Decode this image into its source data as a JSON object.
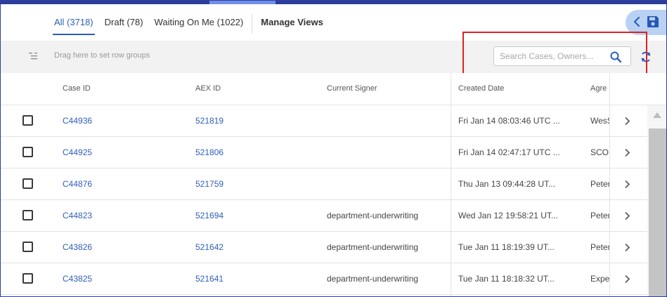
{
  "tabs": [
    {
      "label": "All (3718)",
      "active": true
    },
    {
      "label": "Draft (78)",
      "active": false
    },
    {
      "label": "Waiting On Me (1022)",
      "active": false
    }
  ],
  "manage_views_label": "Manage Views",
  "toolbar": {
    "row_group_hint": "Drag here to set row groups",
    "search_placeholder": "Search Cases, Owners..."
  },
  "table": {
    "columns": [
      "Case ID",
      "AEX ID",
      "Current Signer",
      "Created Date",
      "Agre"
    ],
    "rows": [
      {
        "case_id": "C44936",
        "aex_id": "521819",
        "signer": "",
        "created": "Fri Jan 14 08:03:46 UTC ...",
        "agre": "WesS"
      },
      {
        "case_id": "C44925",
        "aex_id": "521806",
        "signer": "",
        "created": "Fri Jan 14 02:47:17 UTC ...",
        "agre": "SCOF"
      },
      {
        "case_id": "C44876",
        "aex_id": "521759",
        "signer": "",
        "created": "Thu Jan 13 09:44:28 UT...",
        "agre": "Peter"
      },
      {
        "case_id": "C44823",
        "aex_id": "521694",
        "signer": "department-underwriting",
        "created": "Wed Jan 12 19:58:21 UT...",
        "agre": "Peter"
      },
      {
        "case_id": "C43826",
        "aex_id": "521642",
        "signer": "department-underwriting",
        "created": "Tue Jan 11 18:19:39 UT...",
        "agre": "Peter"
      },
      {
        "case_id": "C43825",
        "aex_id": "521641",
        "signer": "department-underwriting",
        "created": "Tue Jan 11 18:18:32 UT...",
        "agre": "Expe"
      }
    ]
  },
  "icons": {
    "collapse": "chevron-left-icon",
    "save": "floppy-disk-icon",
    "search": "search-icon",
    "refresh": "refresh-icon",
    "row_groups": "row-groups-icon",
    "row_open": "chevron-right-icon"
  },
  "colors": {
    "accent_link": "#2e5fb8",
    "top_bar": "#2b3d98",
    "fab_bg": "#b9d2f3",
    "highlight": "#e02020"
  }
}
